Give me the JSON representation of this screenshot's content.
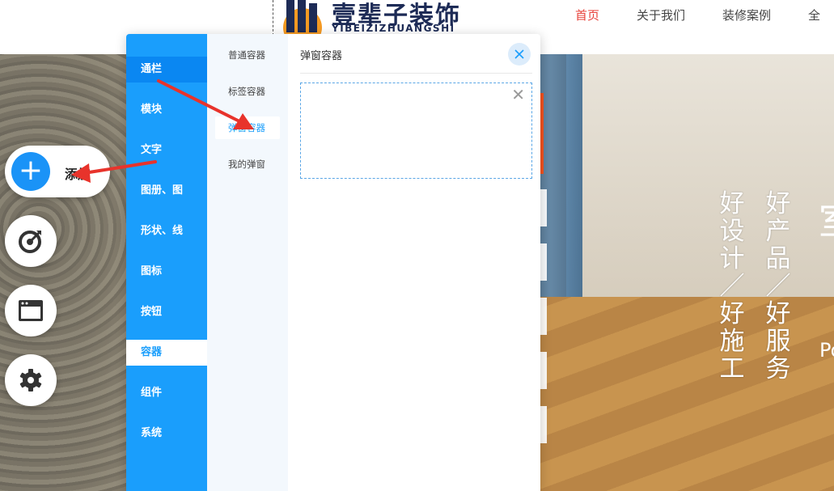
{
  "header": {
    "logo_title": "壹辈子装饰",
    "logo_subtitle": "YIBEIZIZHUANGSHI",
    "nav": [
      {
        "label": "首页",
        "active": true
      },
      {
        "label": "关于我们",
        "active": false
      },
      {
        "label": "装修案例",
        "active": false
      },
      {
        "label": "全",
        "active": false
      }
    ]
  },
  "hero": {
    "slogan_col1": [
      "好",
      "设",
      "计",
      "／",
      "好",
      "施",
      "工"
    ],
    "slogan_col2": [
      "好",
      "产",
      "品",
      "／",
      "好",
      "服",
      "务"
    ],
    "big_char": "室",
    "po_text": "Po"
  },
  "floating": {
    "add_label": "添加"
  },
  "panel": {
    "categories": [
      {
        "label": "通栏",
        "state": "hover"
      },
      {
        "label": "模块",
        "state": ""
      },
      {
        "label": "文字",
        "state": ""
      },
      {
        "label": "图册、图",
        "state": ""
      },
      {
        "label": "形状、线",
        "state": ""
      },
      {
        "label": "图标",
        "state": ""
      },
      {
        "label": "按钮",
        "state": ""
      },
      {
        "label": "容器",
        "state": "active"
      },
      {
        "label": "组件",
        "state": ""
      },
      {
        "label": "系统",
        "state": ""
      }
    ],
    "subcategories": [
      {
        "label": "普通容器",
        "active": false
      },
      {
        "label": "标签容器",
        "active": false
      },
      {
        "label": "弹窗容器",
        "active": true
      },
      {
        "label": "我的弹窗",
        "active": false
      }
    ],
    "content_title": "弹窗容器"
  },
  "colors": {
    "primary": "#1a9efc",
    "nav_active": "#e8413a",
    "annotation": "#e8332b"
  }
}
